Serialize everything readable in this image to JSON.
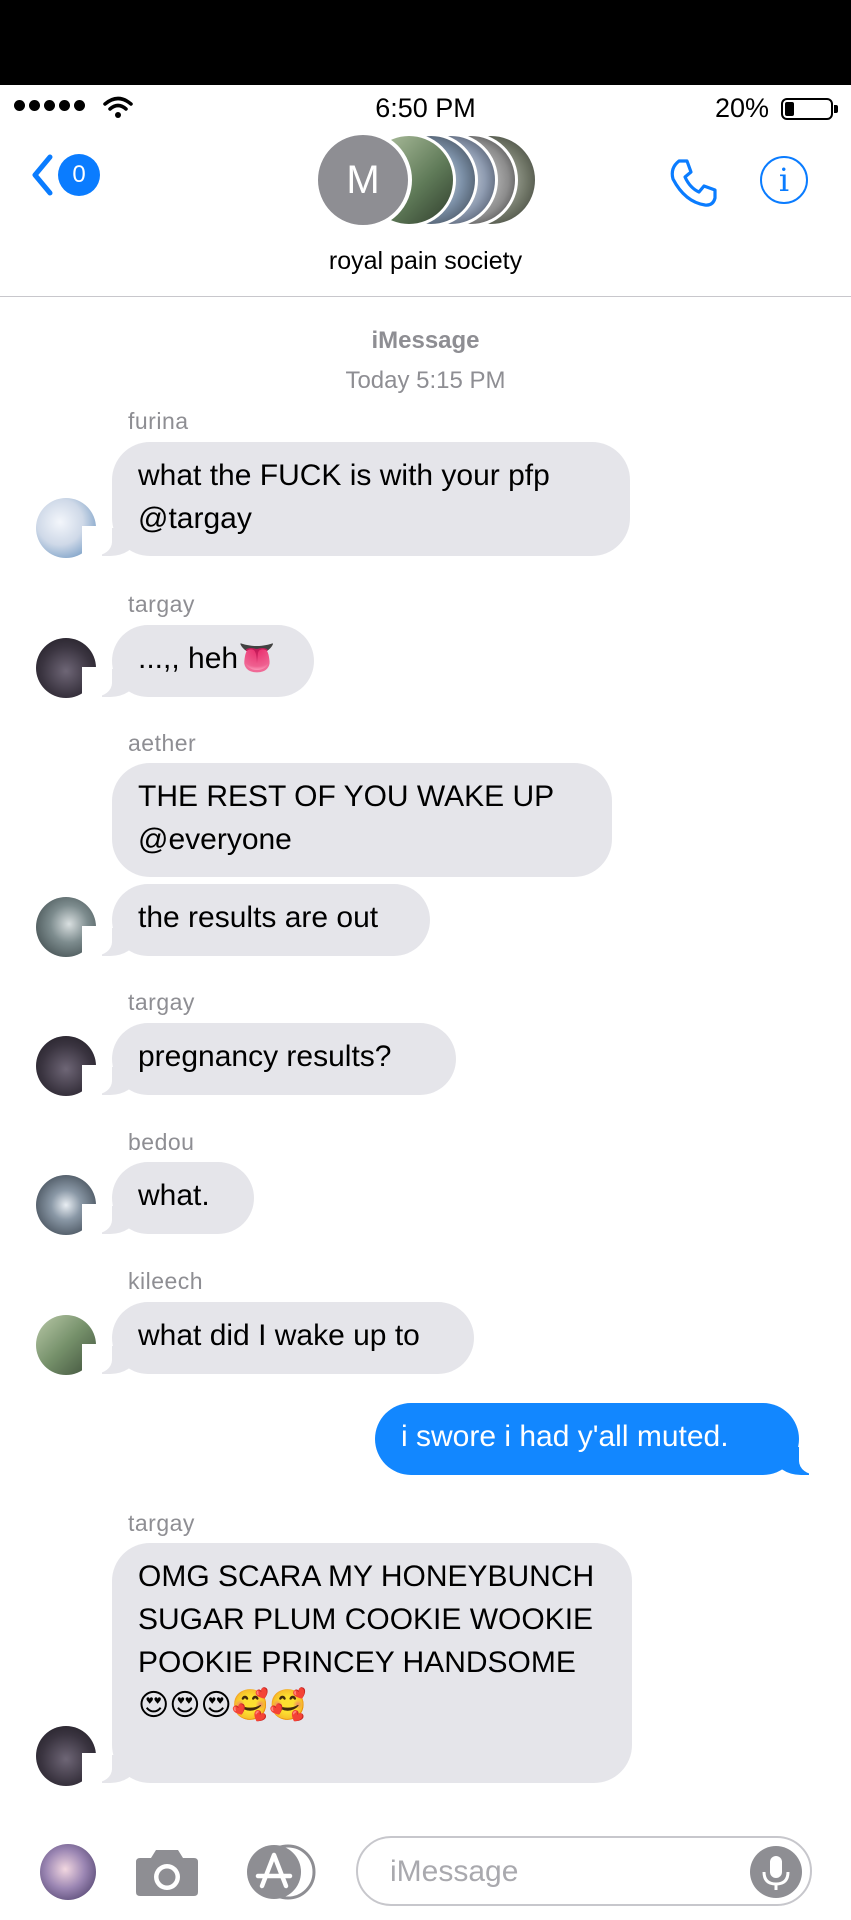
{
  "status_bar": {
    "time": "6:50 PM",
    "battery_percent": "20%",
    "battery_level": 0.2
  },
  "header": {
    "back_badge": "0",
    "avatar_initial": "M",
    "group_name": "royal pain society"
  },
  "chat": {
    "service_label": "iMessage",
    "timestamp": "Today 5:15 PM",
    "messages": [
      {
        "sender": "furina",
        "text": "what the FUCK is with your pfp @targay"
      },
      {
        "sender": "targay",
        "text": "...,, heh👅"
      },
      {
        "sender": "aether",
        "text": "THE REST OF YOU WAKE UP @everyone"
      },
      {
        "text": "the results are out"
      },
      {
        "sender": "targay",
        "text": "pregnancy results?"
      },
      {
        "sender": "bedou",
        "text": "what."
      },
      {
        "sender": "kileech",
        "text": "what did I wake up to"
      },
      {
        "text": "i swore i had y'all muted."
      },
      {
        "sender": "targay",
        "text": "OMG SCARA MY HONEYBUNCH SUGAR PLUM COOKIE WOOKIE POOKIE PRINCEY HANDSOME😍😍😍🥰🥰"
      }
    ]
  },
  "input_bar": {
    "placeholder": "iMessage"
  },
  "colors": {
    "accent": "#0a7cff",
    "outgoing_bubble": "#1287ff",
    "incoming_bubble": "#e5e5ea",
    "meta_text": "#8e8e93"
  },
  "icons": [
    "back-chevron-icon",
    "phone-icon",
    "info-icon",
    "camera-icon",
    "app-store-icon",
    "microphone-icon",
    "wifi-icon",
    "battery-icon"
  ]
}
